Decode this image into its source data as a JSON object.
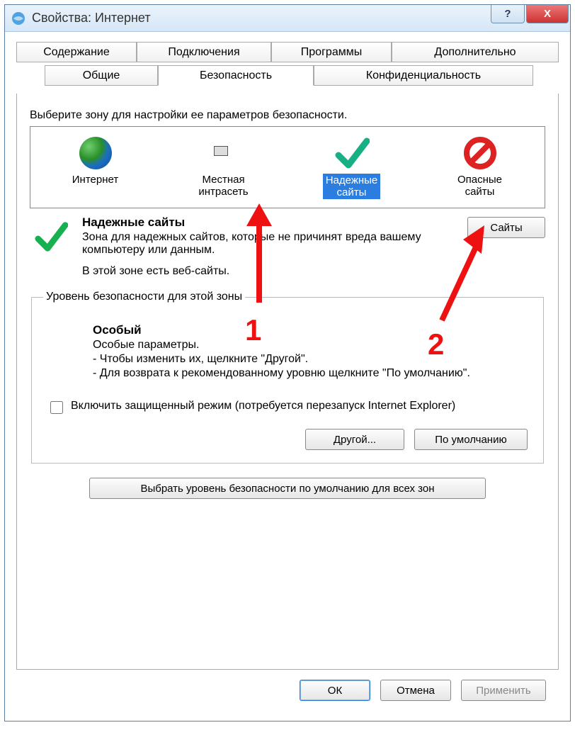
{
  "window": {
    "title": "Свойства: Интернет"
  },
  "titlebar_buttons": {
    "help": "?",
    "close": "X"
  },
  "tabs": {
    "row1": [
      "Содержание",
      "Подключения",
      "Программы",
      "Дополнительно"
    ],
    "row2": [
      "Общие",
      "Безопасность",
      "Конфиденциальность"
    ],
    "active": "Безопасность"
  },
  "zone_select_label": "Выберите зону для настройки ее параметров безопасности.",
  "zones": [
    {
      "id": "internet",
      "label1": "Интернет",
      "label2": "",
      "selected": false
    },
    {
      "id": "intranet",
      "label1": "Местная",
      "label2": "интрасеть",
      "selected": false
    },
    {
      "id": "trusted",
      "label1": "Надежные",
      "label2": "сайты",
      "selected": true
    },
    {
      "id": "restricted",
      "label1": "Опасные",
      "label2": "сайты",
      "selected": false
    }
  ],
  "zone_desc": {
    "title": "Надежные сайты",
    "body": "Зона для надежных сайтов, которые не причинят вреда вашему компьютеру или данным.",
    "footer": "В этой зоне есть веб-сайты."
  },
  "sites_button": "Сайты",
  "security_group": {
    "legend": "Уровень безопасности для этой зоны",
    "level_title": "Особый",
    "line1": "Особые параметры.",
    "line2": "- Чтобы изменить их, щелкните \"Другой\".",
    "line3": "- Для возврата к рекомендованному уровню щелкните \"По умолчанию\".",
    "protected_mode": "Включить защищенный режим (потребуется перезапуск Internet Explorer)",
    "custom_button": "Другой...",
    "default_button": "По умолчанию"
  },
  "reset_button": "Выбрать уровень безопасности по умолчанию для всех зон",
  "footer_buttons": {
    "ok": "ОК",
    "cancel": "Отмена",
    "apply": "Применить"
  },
  "annotations": {
    "n1": "1",
    "n2": "2"
  }
}
